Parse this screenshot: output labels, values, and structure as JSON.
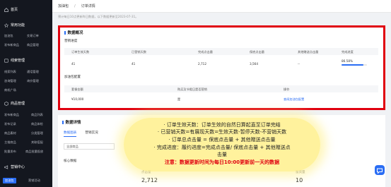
{
  "sidebar": {
    "home": "首页",
    "groups": [
      {
        "label": "常用功能",
        "items": [
          "加油包",
          "交易订单",
          "发布新商品",
          "商品管理"
        ]
      },
      {
        "label": "线索管理",
        "items": [
          "线索列表",
          "通话管理",
          "咨询管理",
          "询价管理",
          "商机广场"
        ]
      },
      {
        "label": "商品管理",
        "items": [
          "发布新商品",
          "商品列表",
          "发布记录",
          "商品体检",
          "商品素材",
          "分类管理",
          "主推商品",
          "关联搭配",
          "批量发布",
          "商品批量投放"
        ]
      },
      {
        "label": "营销中心",
        "items": [
          "加油包",
          "营销活动"
        ]
      }
    ]
  },
  "topbar": {
    "crumb1": "加油包",
    "crumb2": "订单详情"
  },
  "notice": "预计每日10点更新昨日数据，以下数据更新至2023-07-31。",
  "overview": {
    "title": "数据概况",
    "progress_title": "营销进度",
    "headers": [
      "订单生效天数",
      "已营销天数",
      "完成点击量",
      "保底点击量",
      "其他赠送点击量",
      "完成进度"
    ],
    "row": [
      "41",
      "41",
      "2,712",
      "3,564",
      "--",
      "86.58%"
    ],
    "progress_fraction": 0.8658,
    "config_title": "加油包配置",
    "config_headers": [
      "套餐金额",
      "购买及节假日是否营销",
      "操作"
    ],
    "config_row": [
      "¥10,000",
      "是",
      "查阅加油包配置"
    ]
  },
  "details": {
    "title": "数据详情",
    "tabs": [
      "数据图表",
      "营销实况"
    ],
    "select": "全部商品",
    "core": "核心数据",
    "metrics": [
      {
        "label": "点击量",
        "value": "2,712"
      },
      {
        "label": "留资量",
        "value": "10"
      }
    ]
  },
  "overlay": {
    "lines": [
      "· 订单生效天数：订单生效的自然日算起直至订单完结",
      "· 已营销天数=有展现天数=生效天数-暂停天数-不营销天数",
      "· 订单总点击量 = 保底点击量 + 其他赠送点击量",
      "· 完成进度：履约进度=完成点击量/ 保底点击量 + 其他赠送点",
      "击量"
    ],
    "note": "注意：数据更新时间为每日10:00更新前一天的数据"
  },
  "colors": {
    "accent": "#2a6df4",
    "highlight_border": "#e0000f",
    "sidebar_bg": "#14171f",
    "overlay": "#fff08c"
  }
}
